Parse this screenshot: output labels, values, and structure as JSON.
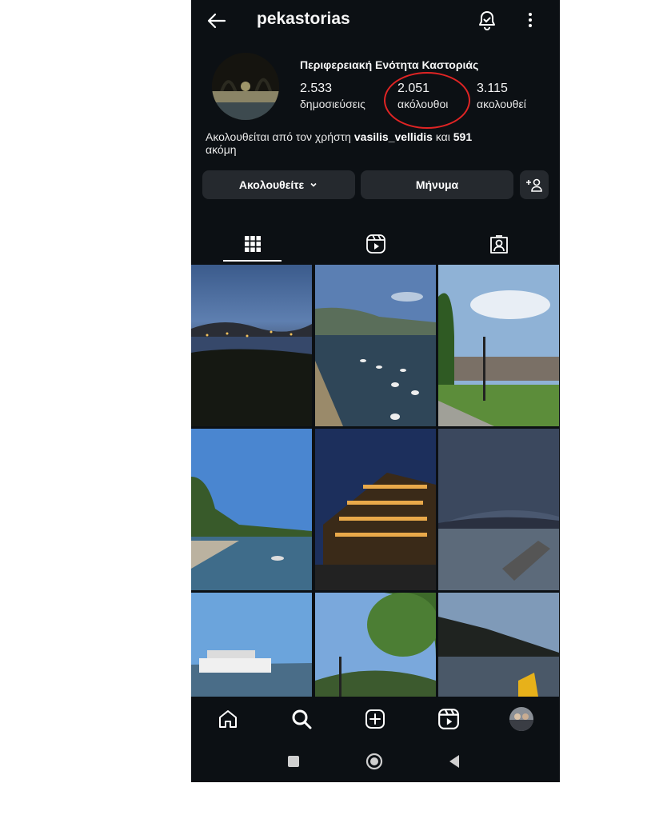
{
  "profile": {
    "username": "pekastorias",
    "display_name": "Περιφερειακή Ενότητα Καστοριάς",
    "stats": [
      {
        "value": "2.533",
        "label": "δημοσιεύσεις"
      },
      {
        "value": "2.051",
        "label": "ακόλουθοι"
      },
      {
        "value": "3.115",
        "label": "ακολουθεί"
      }
    ],
    "followed_by_prefix": "Ακολουθείται από τον χρήστη ",
    "followed_by_user": "vasilis_vellidis",
    "followed_by_middle": " και ",
    "followed_by_count": "591",
    "followed_by_suffix": "ακόμη"
  },
  "buttons": {
    "following_label": "Ακολουθείτε",
    "message_label": "Μήνυμα"
  },
  "icons": {
    "back": "arrow-left-icon",
    "notifications": "bell-icon",
    "more": "more-vertical-icon",
    "add_user": "add-user-icon",
    "grid_tab": "grid-icon",
    "reels_tab": "reels-icon",
    "tagged_tab": "tagged-icon",
    "home": "home-icon",
    "search": "search-icon",
    "create": "plus-square-icon",
    "reels": "reels-icon",
    "profile": "avatar-icon"
  },
  "colors": {
    "background": "#0c1014",
    "button": "#25292e",
    "highlight_ring": "#e02424"
  }
}
